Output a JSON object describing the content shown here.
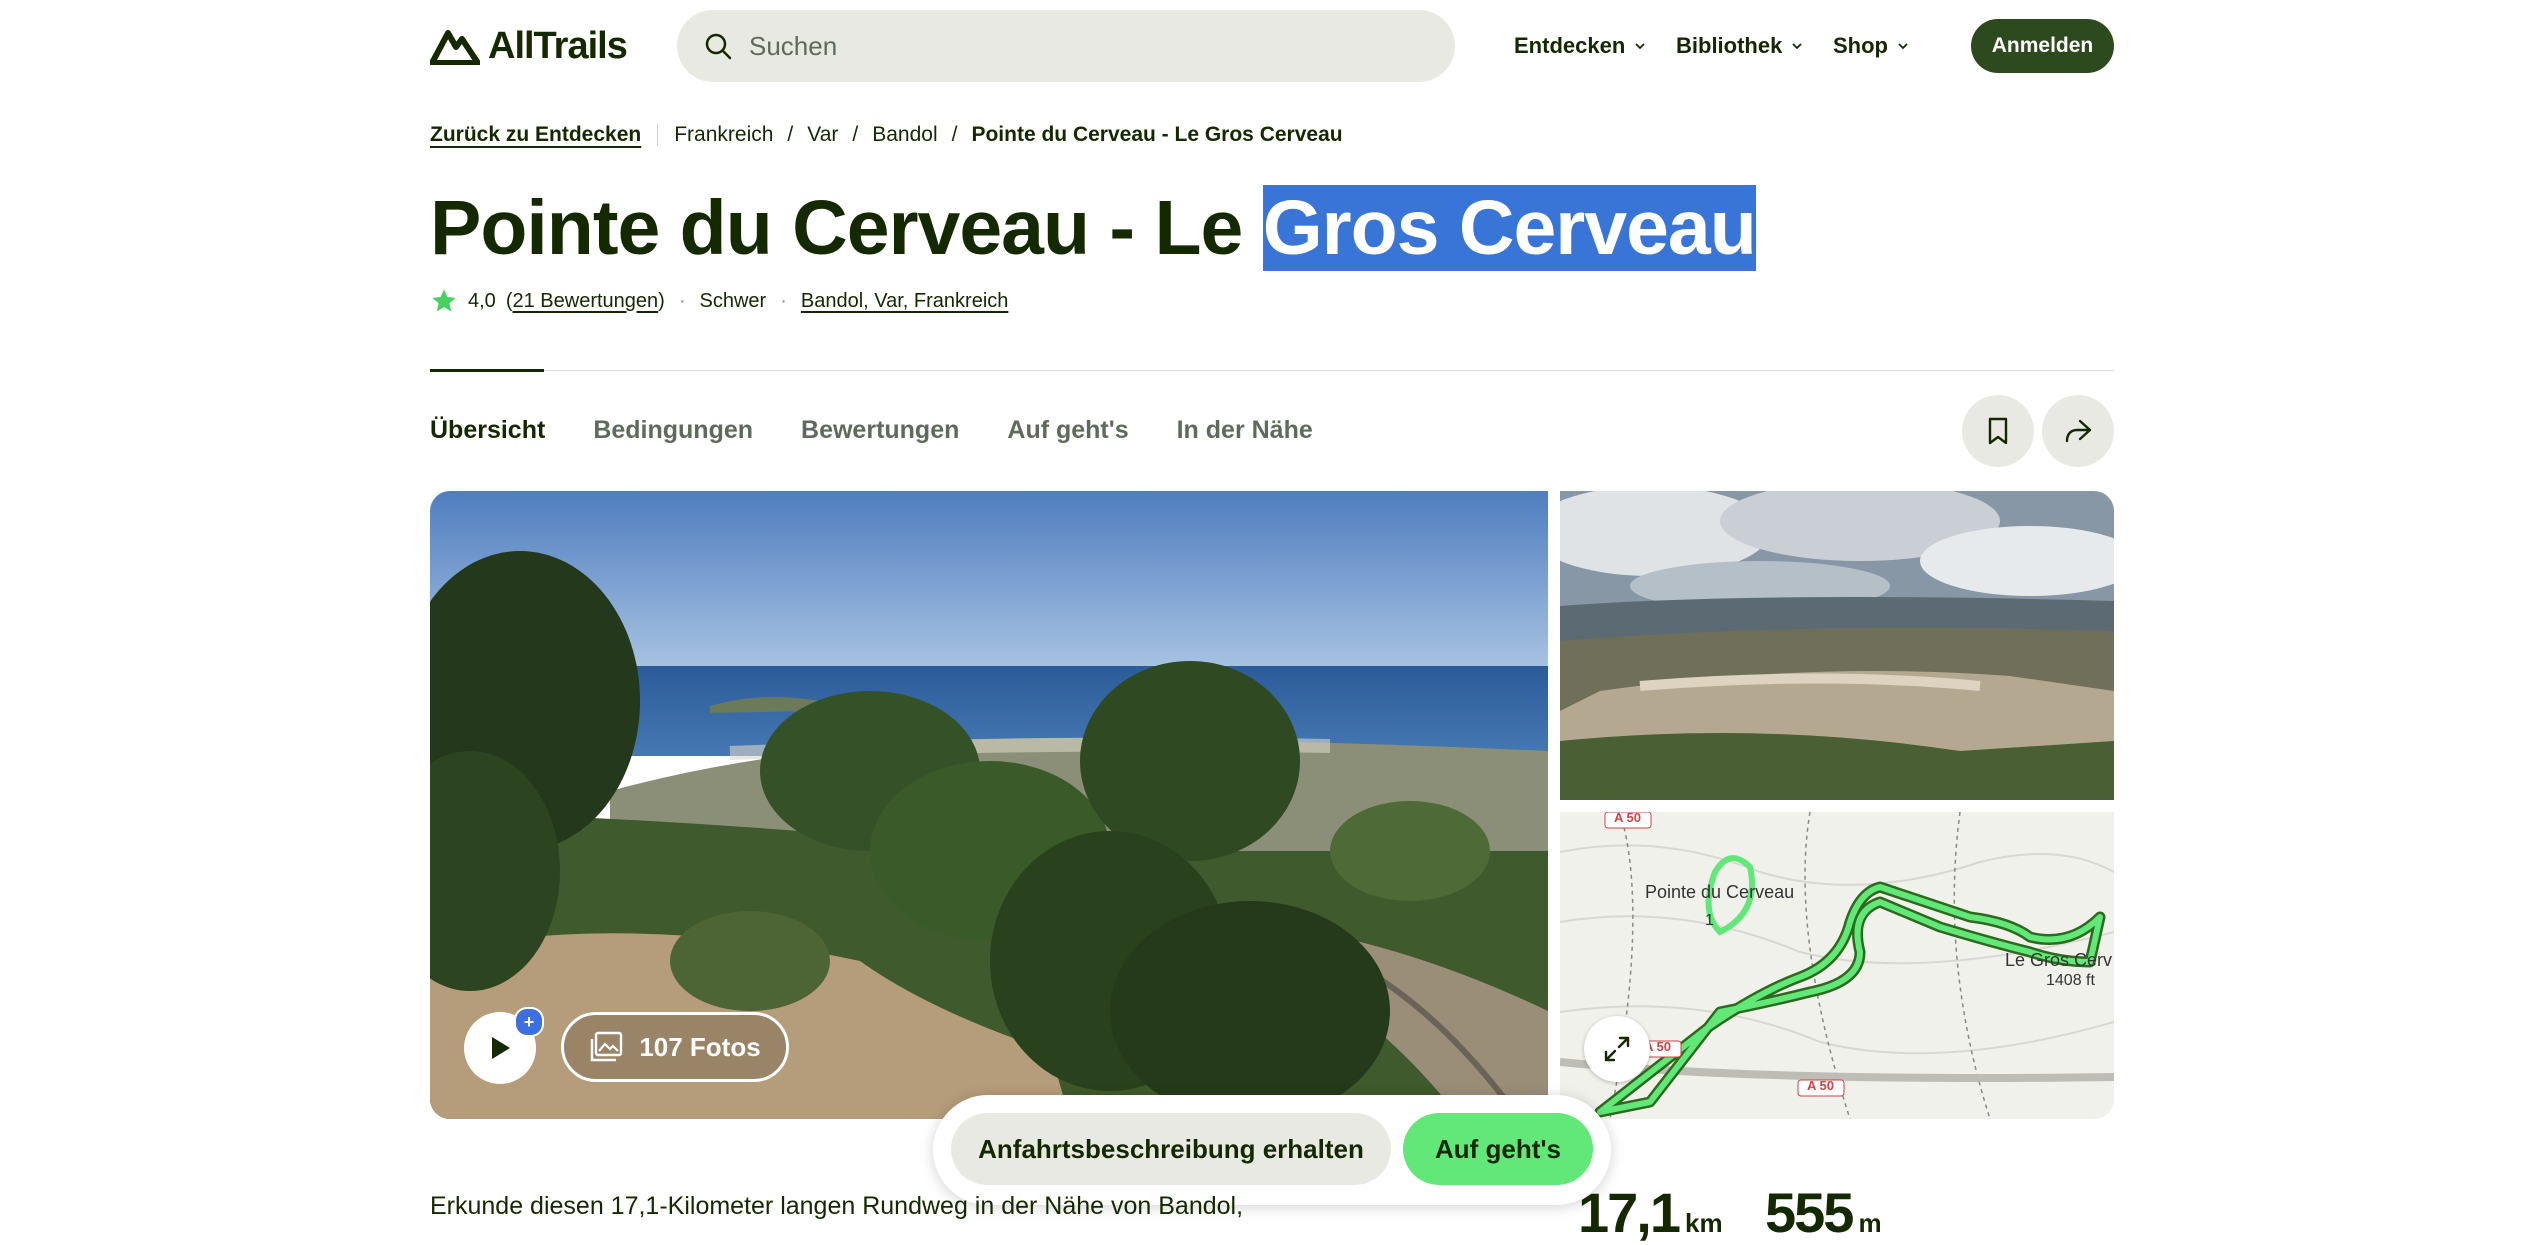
{
  "header": {
    "logo_text": "AllTrails",
    "search_placeholder": "Suchen",
    "nav": [
      {
        "label": "Entdecken"
      },
      {
        "label": "Bibliothek"
      },
      {
        "label": "Shop"
      }
    ],
    "signin_label": "Anmelden"
  },
  "breadcrumb": {
    "back_label": "Zurück zu Entdecken",
    "items": [
      "Frankreich",
      "Var",
      "Bandol"
    ],
    "current": "Pointe du Cerveau - Le Gros Cerveau"
  },
  "trail": {
    "title_plain": "Pointe du Cerveau - Le ",
    "title_selected": "Gros Cerveau",
    "rating": "4,0",
    "reviews": "21 Bewertungen",
    "difficulty": "Schwer",
    "location": "Bandol, Var, Frankreich"
  },
  "tabs": [
    {
      "label": "Übersicht",
      "active": true
    },
    {
      "label": "Bedingungen"
    },
    {
      "label": "Bewertungen"
    },
    {
      "label": "Auf geht's"
    },
    {
      "label": "In der Nähe"
    }
  ],
  "media": {
    "photos_label": "107 Fotos",
    "plus_badge": "+",
    "map_labels": {
      "peak_name": "Pointe du Cerveau",
      "peak_alt": "1",
      "east_name": "Le Gros Cerv",
      "east_alt": "1408 ft",
      "road1": "A 50",
      "road2": "A 50",
      "road3": "A 50"
    }
  },
  "actions": {
    "directions_label": "Anfahrtsbeschreibung erhalten",
    "go_label": "Auf geht's"
  },
  "description": "Erkunde diesen 17,1-Kilometer langen Rundweg in der Nähe von Bandol,",
  "stats": {
    "length_value": "17,1",
    "length_unit": "km",
    "elevation_value": "555",
    "elevation_unit": "m"
  },
  "colors": {
    "brand": "#142900",
    "accent_green": "#62e879",
    "signin_bg": "#2d4a1e",
    "selection": "#3875d7",
    "star": "#46d160"
  }
}
